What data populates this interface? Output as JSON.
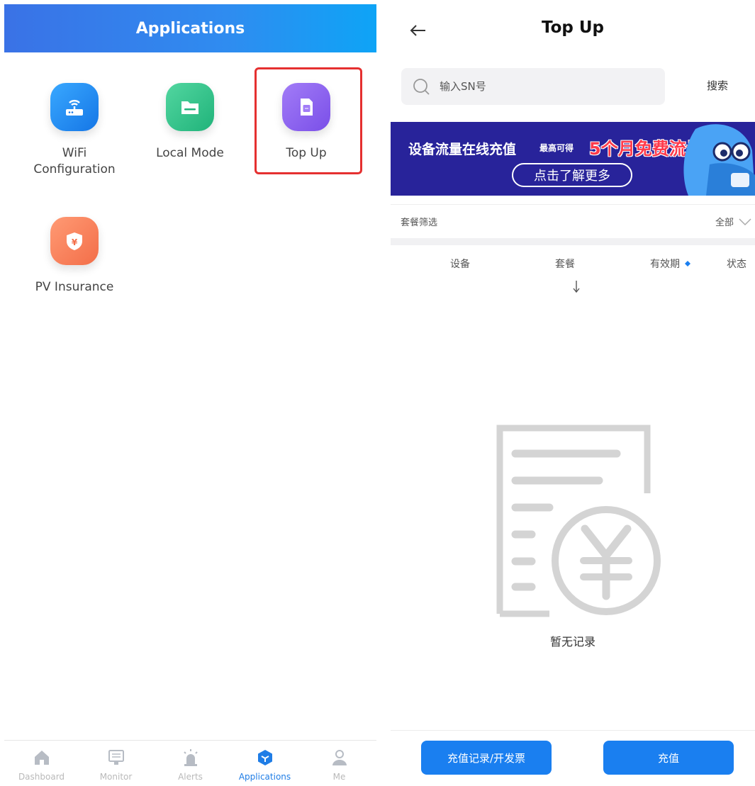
{
  "applications": {
    "title": "Applications",
    "apps": [
      {
        "label": "WiFi Configuration",
        "icon": "router-icon"
      },
      {
        "label": "Local Mode",
        "icon": "folder-icon"
      },
      {
        "label": "Top Up",
        "icon": "sim-card-icon"
      },
      {
        "label": "PV Insurance",
        "icon": "shield-yen-icon"
      }
    ],
    "tabs": [
      {
        "label": "Dashboard",
        "icon": "home-icon",
        "active": false
      },
      {
        "label": "Monitor",
        "icon": "monitor-icon",
        "active": false
      },
      {
        "label": "Alerts",
        "icon": "alarm-icon",
        "active": false
      },
      {
        "label": "Applications",
        "icon": "cube-icon",
        "active": true
      },
      {
        "label": "Me",
        "icon": "user-icon",
        "active": false
      }
    ],
    "highlight_color": "#e53030",
    "accent": "#1f7de6"
  },
  "topup": {
    "title": "Top Up",
    "search": {
      "placeholder": "输入SN号",
      "button": "搜索"
    },
    "banner": {
      "headline": "设备流量在线充值",
      "sub": "最高可得",
      "promo": "5个月免费流量",
      "cta": "点击了解更多"
    },
    "filter": {
      "label": "套餐筛选",
      "value": "全部"
    },
    "table_headers": {
      "device": "设备",
      "package": "套餐",
      "validity": "有效期",
      "status": "状态"
    },
    "empty_text": "暂无记录",
    "buttons": {
      "records": "充值记录/开发票",
      "recharge": "充值"
    },
    "primary_color": "#1a7ff0"
  }
}
